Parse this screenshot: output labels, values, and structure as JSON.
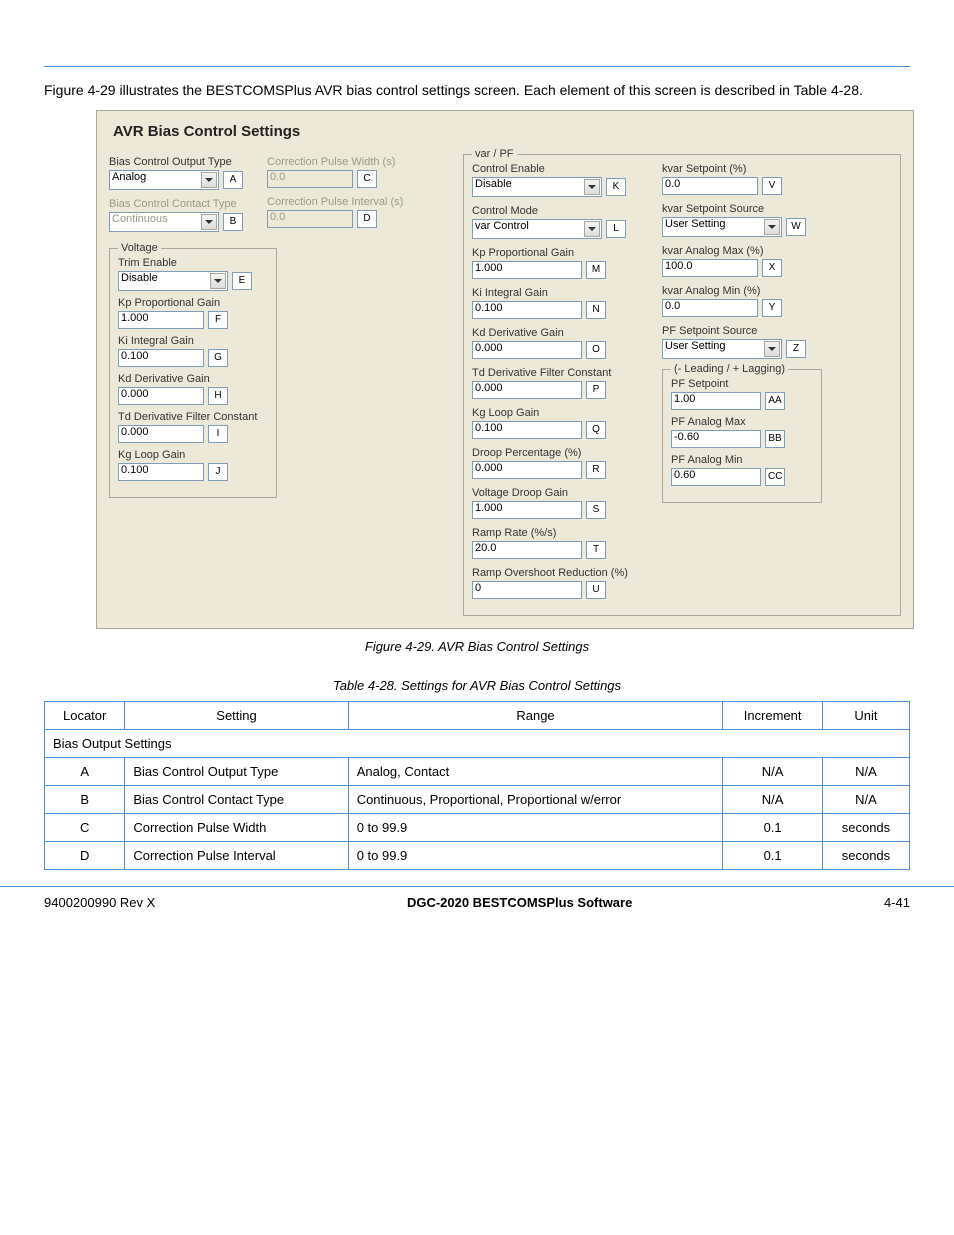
{
  "intro_text": "Figure 4-29 illustrates the BESTCOMSPlus AVR bias control settings screen. Each element of this screen is described in Table 4-28.",
  "caption": "Figure 4-29. AVR Bias Control Settings",
  "ui": {
    "title": "AVR Bias Control Settings",
    "c1": {
      "bias_output_type_label": "Bias Control Output Type",
      "bias_output_type_value": "Analog",
      "bias_output_type_tag": "A",
      "bias_contact_type_label": "Bias Control Contact Type",
      "bias_contact_type_value": "Continuous",
      "bias_contact_type_tag": "B"
    },
    "c1b": {
      "corr_pw_label": "Correction Pulse Width (s)",
      "corr_pw_value": "0.0",
      "corr_pw_tag": "C",
      "corr_pi_label": "Correction Pulse Interval (s)",
      "corr_pi_value": "0.0",
      "corr_pi_tag": "D"
    },
    "voltage": {
      "legend": "Voltage",
      "trim_label": "Trim Enable",
      "trim_value": "Disable",
      "trim_tag": "E",
      "kp_label": "Kp Proportional Gain",
      "kp_value": "1.000",
      "kp_tag": "F",
      "ki_label": "Ki Integral Gain",
      "ki_value": "0.100",
      "ki_tag": "G",
      "kd_label": "Kd Derivative Gain",
      "kd_value": "0.000",
      "kd_tag": "H",
      "td_label": "Td Derivative Filter Constant",
      "td_value": "0.000",
      "td_tag": "I",
      "kg_label": "Kg Loop Gain",
      "kg_value": "0.100",
      "kg_tag": "J"
    },
    "varpf": {
      "legend": "var / PF",
      "ce_label": "Control Enable",
      "ce_value": "Disable",
      "ce_tag": "K",
      "cm_label": "Control Mode",
      "cm_value": "var Control",
      "cm_tag": "L",
      "kp_label": "Kp Proportional Gain",
      "kp_value": "1.000",
      "kp_tag": "M",
      "ki_label": "Ki Integral Gain",
      "ki_value": "0.100",
      "ki_tag": "N",
      "kd_label": "Kd Derivative Gain",
      "kd_value": "0.000",
      "kd_tag": "O",
      "td_label": "Td Derivative Filter Constant",
      "td_value": "0.000",
      "td_tag": "P",
      "kg_label": "Kg Loop Gain",
      "kg_value": "0.100",
      "kg_tag": "Q",
      "dp_label": "Droop Percentage (%)",
      "dp_value": "0.000",
      "dp_tag": "R",
      "vdg_label": "Voltage Droop Gain",
      "vdg_value": "1.000",
      "vdg_tag": "S",
      "rr_label": "Ramp Rate (%/s)",
      "rr_value": "20.0",
      "rr_tag": "T",
      "ror_label": "Ramp Overshoot Reduction (%)",
      "ror_value": "0",
      "ror_tag": "U"
    },
    "right": {
      "ksp_label": "kvar Setpoint (%)",
      "ksp_value": "0.0",
      "ksp_tag": "V",
      "kss_label": "kvar Setpoint Source",
      "kss_value": "User Setting",
      "kss_tag": "W",
      "kamax_label": "kvar Analog Max (%)",
      "kamax_value": "100.0",
      "kamax_tag": "X",
      "kamin_label": "kvar Analog Min (%)",
      "kamin_value": "0.0",
      "kamin_tag": "Y",
      "pfs_label": "PF Setpoint Source",
      "pfs_value": "User Setting",
      "pfs_tag": "Z",
      "lead_lag_legend": "(- Leading / + Lagging)",
      "pfsp_label": "PF Setpoint",
      "pfsp_value": "1.00",
      "pfsp_tag": "AA",
      "pamax_label": "PF Analog Max",
      "pamax_value": "-0.60",
      "pamax_tag": "BB",
      "pamin_label": "PF Analog Min",
      "pamin_value": "0.60",
      "pamin_tag": "CC"
    }
  },
  "table": {
    "caption": "Table 4-28. Settings for AVR Bias Control Settings",
    "head": [
      "Locator",
      "Setting",
      "Range",
      "Increment",
      "Unit"
    ],
    "group1": "Bias Output Settings",
    "rows": [
      [
        "A",
        "Bias Control Output Type",
        "Analog, Contact",
        "N/A",
        "N/A"
      ],
      [
        "B",
        "Bias Control Contact Type",
        "Continuous, Proportional, Proportional w/error",
        "N/A",
        "N/A"
      ],
      [
        "C",
        "Correction Pulse Width",
        "0 to 99.9",
        "0.1",
        "seconds"
      ],
      [
        "D",
        "Correction Pulse Interval",
        "0 to 99.9",
        "0.1",
        "seconds"
      ]
    ]
  },
  "footer": {
    "left": "9400200990 Rev X",
    "mid": "DGC-2020 BESTCOMSPlus Software",
    "right": "4-41"
  }
}
